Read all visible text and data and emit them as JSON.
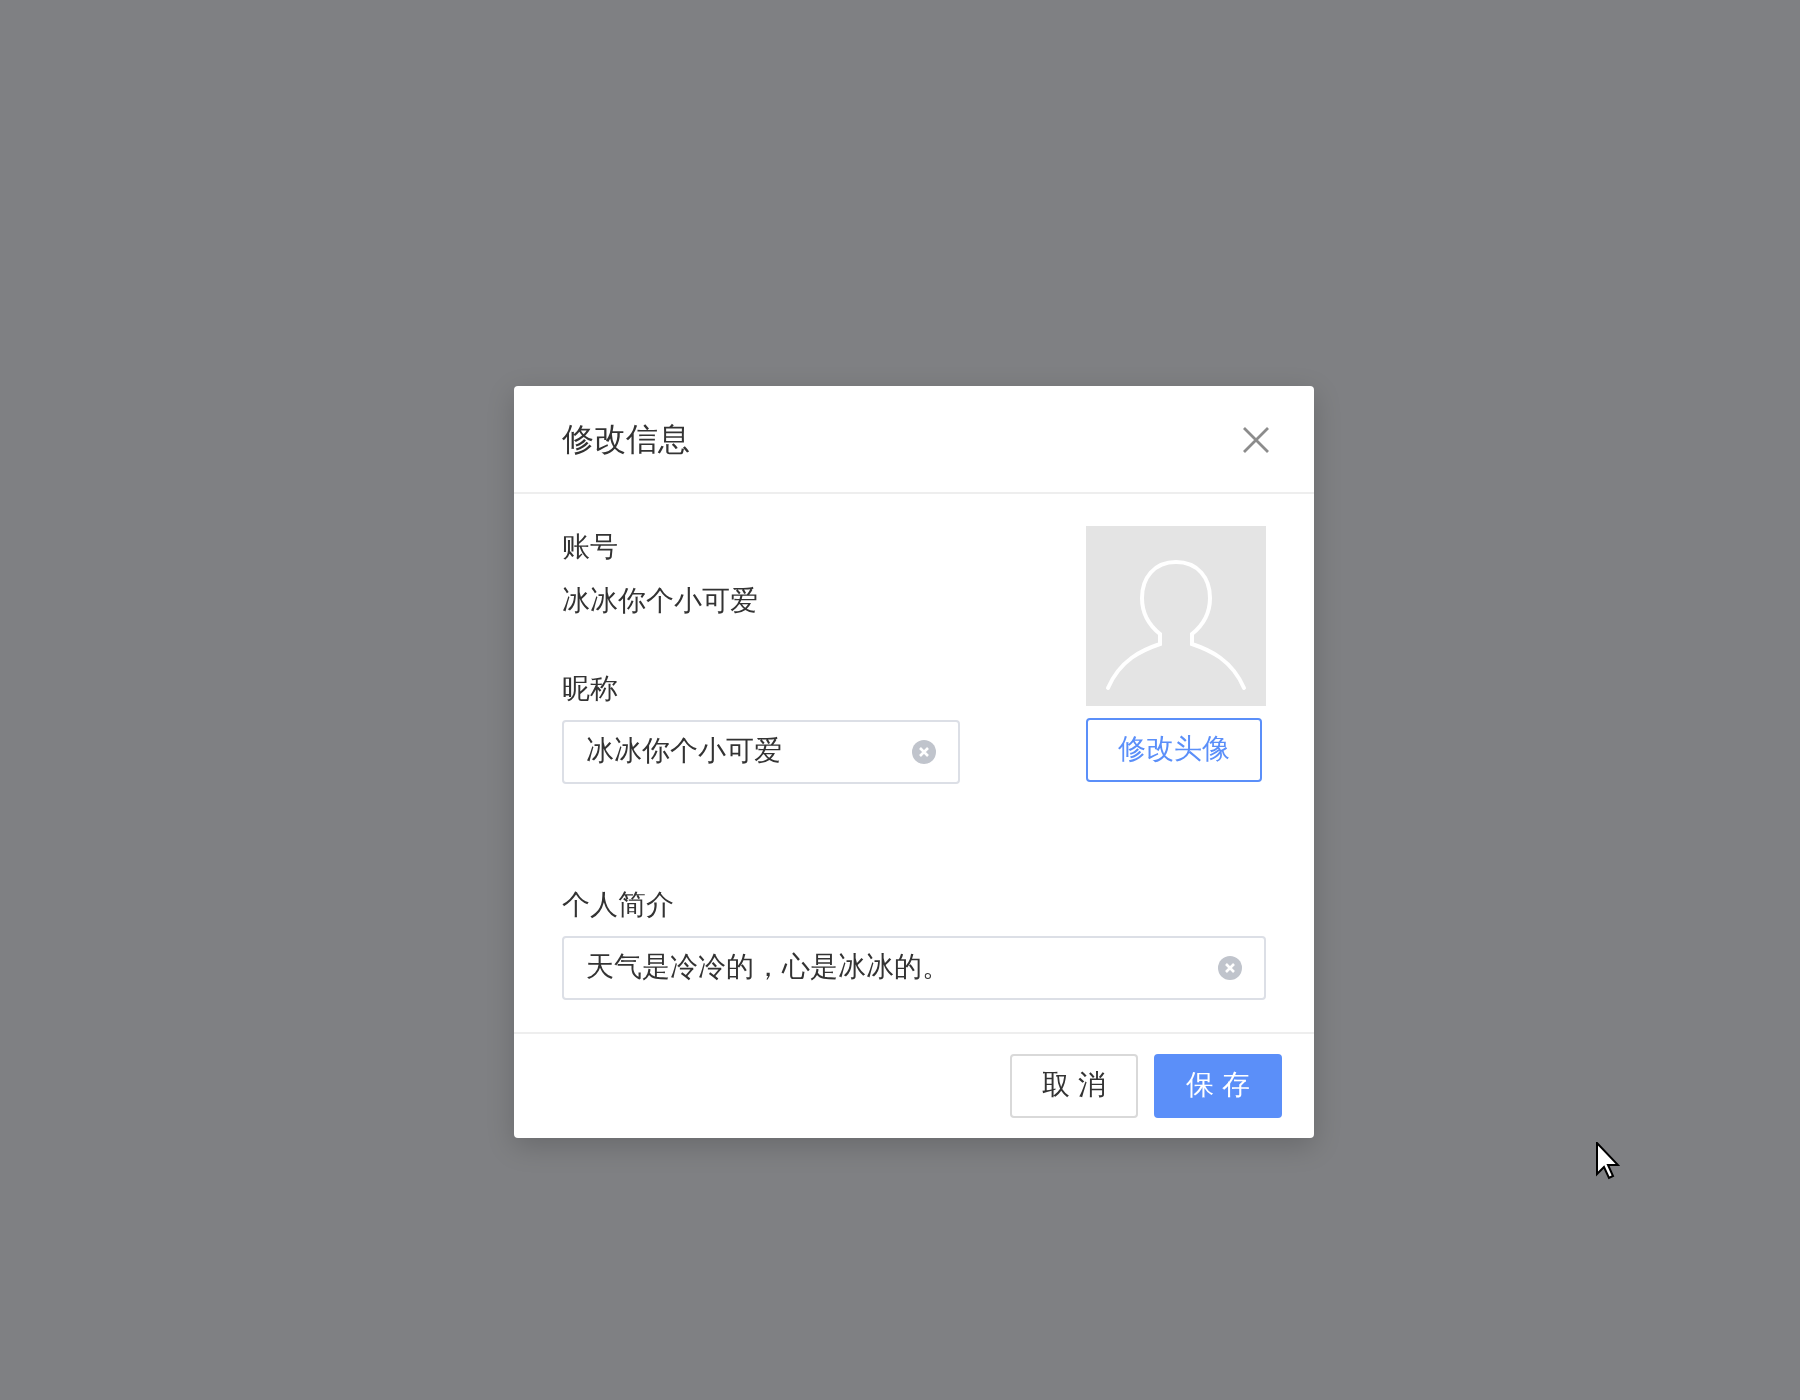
{
  "dialog": {
    "title": "修改信息"
  },
  "fields": [
    {
      "kind": "text",
      "label": "账号",
      "value": "冰冰你个小可爱"
    },
    {
      "kind": "input",
      "label": "昵称",
      "value": "冰冰你个小可爱"
    }
  ],
  "avatar": {
    "button": "修改头像"
  },
  "bio": {
    "label": "个人简介",
    "value": "天气是冷冷的，心是冰冰的。"
  },
  "buttons": [
    {
      "kind": "default",
      "label": "取 消"
    },
    {
      "kind": "primary",
      "label": "保 存"
    }
  ]
}
